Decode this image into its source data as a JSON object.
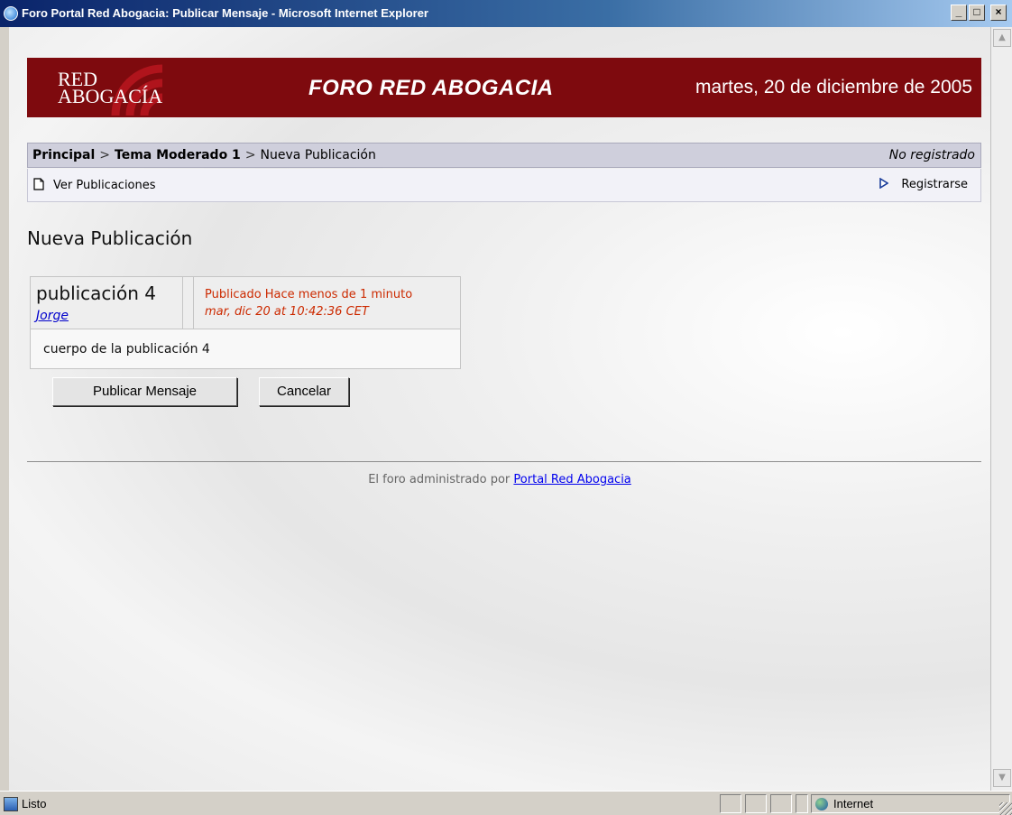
{
  "window": {
    "title": "Foro Portal Red Abogacia: Publicar Mensaje - Microsoft Internet Explorer",
    "controls": {
      "minimize": "_",
      "maximize": "□",
      "close": "×"
    }
  },
  "banner": {
    "logo_line1": "RED",
    "logo_line2": "ABOGACÍA",
    "title": "FORO RED ABOGACIA",
    "date": "martes, 20 de diciembre de 2005",
    "background_color": "#7e0a0e"
  },
  "breadcrumb": {
    "items": [
      "Principal",
      "Tema Moderado 1",
      "Nueva Publicación"
    ],
    "separator": ">",
    "user_status": "No registrado"
  },
  "actions": {
    "view_posts": "Ver Publicaciones",
    "register": "Registrarse"
  },
  "page": {
    "heading": "Nueva Publicación"
  },
  "post": {
    "title": "publicación 4",
    "author": "Jorge",
    "posted_label": "Publicado Hace menos de 1 minuto",
    "posted_date": "mar, dic 20 at 10:42:36 CET",
    "body": "cuerpo de la publicación 4",
    "meta_color": "#cc2a00"
  },
  "buttons": {
    "publish": "Publicar Mensaje",
    "cancel": "Cancelar"
  },
  "footer": {
    "text": "El foro administrado por",
    "link": "Portal Red Abogacia"
  },
  "statusbar": {
    "status": "Listo",
    "zone": "Internet"
  },
  "icons": {
    "view_posts_icon": "document-icon",
    "register_icon": "triangle-right-icon",
    "browser_icon": "ie-icon",
    "zone_icon": "globe-icon"
  }
}
